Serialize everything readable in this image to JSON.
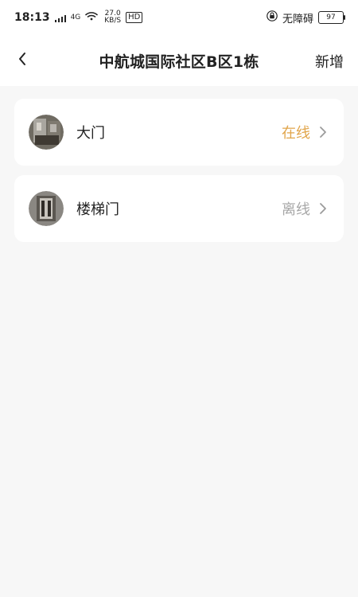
{
  "status_bar": {
    "time": "18:13",
    "signal_text": "4G",
    "speed_value": "27.0",
    "speed_unit": "KB/S",
    "hd_label": "HD",
    "accessibility_text": "无障碍",
    "battery_level": "97"
  },
  "header": {
    "title": "中航城国际社区B区1栋",
    "action_label": "新增"
  },
  "devices": [
    {
      "name": "大门",
      "status": "在线",
      "status_color": "#e1a54b"
    },
    {
      "name": "楼梯门",
      "status": "离线",
      "status_color": "#a7a7a7"
    }
  ],
  "colors": {
    "background": "#f7f7f7",
    "card": "#ffffff",
    "online": "#e1a54b",
    "offline": "#a7a7a7",
    "text": "#222222"
  },
  "icons": {
    "back": "chevron-left-icon",
    "chevron": "chevron-right-icon",
    "lock": "lock-icon",
    "wifi": "wifi-icon",
    "signal": "signal-icon"
  }
}
